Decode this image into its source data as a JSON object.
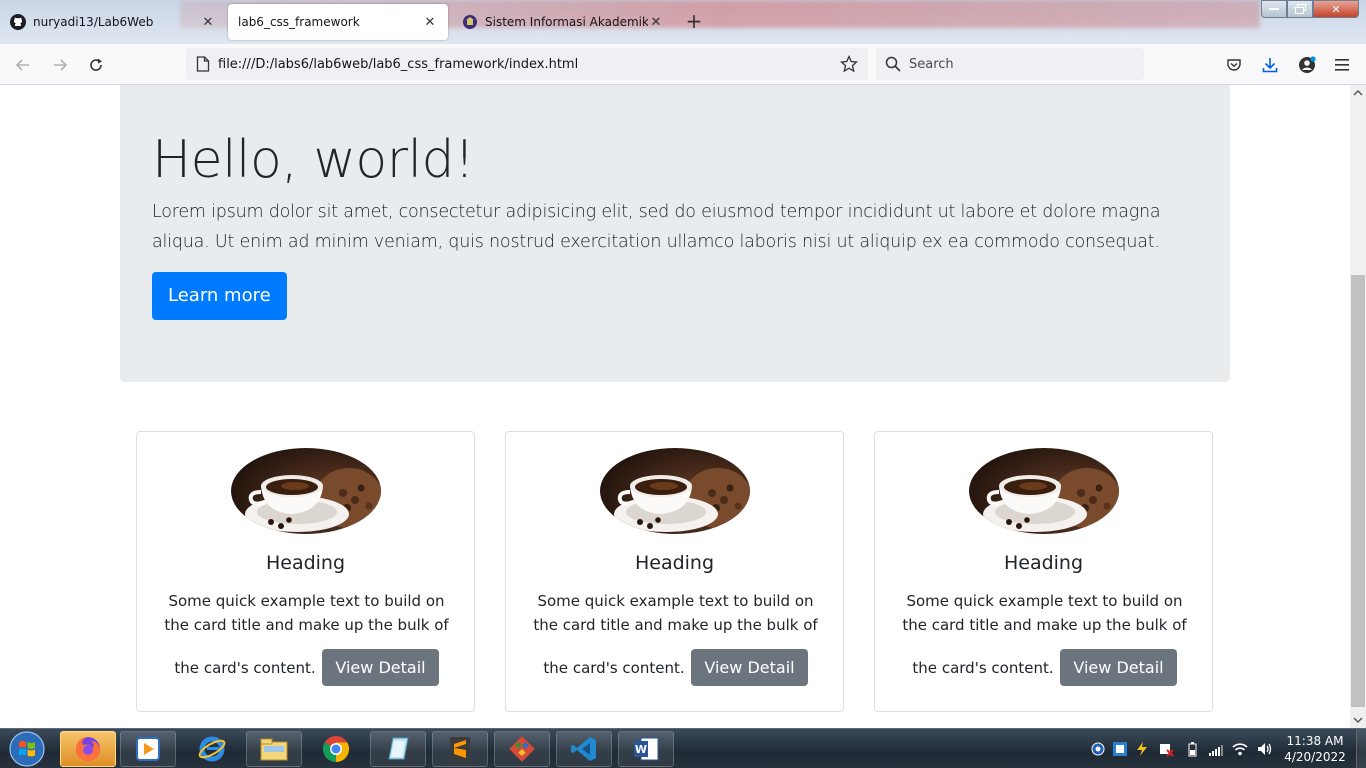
{
  "browser": {
    "tabs": [
      {
        "label": "nuryadi13/Lab6Web",
        "icon": "github-icon"
      },
      {
        "label": "lab6_css_framework",
        "icon": "none"
      },
      {
        "label": "Sistem Informasi Akademik",
        "icon": "university-icon"
      }
    ],
    "url": "file:///D:/labs6/lab6web/lab6_css_framework/index.html",
    "search_placeholder": "Search"
  },
  "page": {
    "jumbotron": {
      "title": "Hello, world!",
      "lead": "Lorem ipsum dolor sit amet, consectetur adipisicing elit, sed do eiusmod tempor incididunt ut labore et dolore magna aliqua. Ut enim ad minim veniam, quis nostrud exercitation ullamco laboris nisi ut aliquip ex ea commodo consequat.",
      "button": "Learn more",
      "button_color": "#007bff"
    },
    "cards": [
      {
        "heading": "Heading",
        "text_main": "Some quick example text to build on the card title and make up the bulk of the",
        "text_last": "card's content.",
        "button": "View Detail",
        "image": "coffee-cup-image"
      },
      {
        "heading": "Heading",
        "text_main": "Some quick example text to build on the card title and make up the bulk of the",
        "text_last": "card's content.",
        "button": "View Detail",
        "image": "coffee-cup-image"
      },
      {
        "heading": "Heading",
        "text_main": "Some quick example text to build on the card title and make up the bulk of the",
        "text_last": "card's content.",
        "button": "View Detail",
        "image": "coffee-cup-image"
      }
    ]
  },
  "taskbar": {
    "apps": [
      "firefox-icon",
      "media-player-icon",
      "internet-explorer-icon",
      "file-explorer-icon",
      "chrome-icon",
      "notepad-icon",
      "sublime-text-icon",
      "git-icon",
      "vscode-icon",
      "word-icon"
    ],
    "clock_time": "11:38 AM",
    "clock_date": "4/20/2022"
  }
}
